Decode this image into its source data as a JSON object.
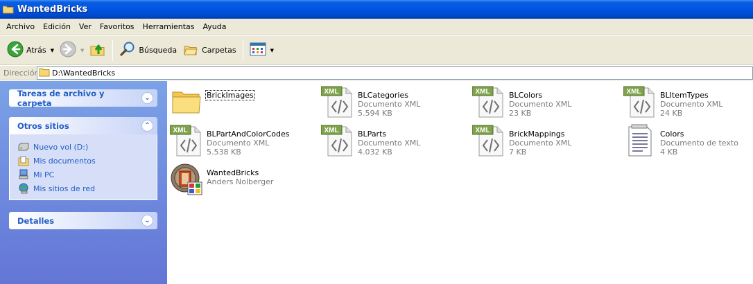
{
  "window": {
    "title": "WantedBricks"
  },
  "menu": [
    "Archivo",
    "Edición",
    "Ver",
    "Favoritos",
    "Herramientas",
    "Ayuda"
  ],
  "toolbar": {
    "back_label": "Atrás",
    "search_label": "Búsqueda",
    "folders_label": "Carpetas"
  },
  "address": {
    "label": "Dirección",
    "path": "D:\\WantedBricks"
  },
  "taskpane": {
    "file_tasks": {
      "title": "Tareas de archivo y carpeta"
    },
    "other_places": {
      "title": "Otros sitios",
      "items": [
        {
          "label": "Nuevo vol (D:)",
          "icon": "drive-icon"
        },
        {
          "label": "Mis documentos",
          "icon": "my-documents-icon"
        },
        {
          "label": "Mi PC",
          "icon": "my-computer-icon"
        },
        {
          "label": "Mis sitios de red",
          "icon": "network-places-icon"
        }
      ]
    },
    "details": {
      "title": "Detalles"
    }
  },
  "files": [
    {
      "name": "BrickImages",
      "line1": "",
      "line2": "",
      "type": "folder"
    },
    {
      "name": "BLCategories",
      "line1": "Documento XML",
      "line2": "5.594 KB",
      "type": "xml"
    },
    {
      "name": "BLColors",
      "line1": "Documento XML",
      "line2": "23 KB",
      "type": "xml"
    },
    {
      "name": "BLItemTypes",
      "line1": "Documento XML",
      "line2": "24 KB",
      "type": "xml"
    },
    {
      "name": "BLPartAndColorCodes",
      "line1": "Documento XML",
      "line2": "5.538 KB",
      "type": "xml"
    },
    {
      "name": "BLParts",
      "line1": "Documento XML",
      "line2": "4.032 KB",
      "type": "xml"
    },
    {
      "name": "BrickMappings",
      "line1": "Documento XML",
      "line2": "7 KB",
      "type": "xml"
    },
    {
      "name": "Colors",
      "line1": "Documento de texto",
      "line2": "4 KB",
      "type": "text"
    },
    {
      "name": "WantedBricks",
      "line1": "Anders Nolberger",
      "line2": "",
      "type": "app"
    }
  ],
  "icon_badge": "XML"
}
